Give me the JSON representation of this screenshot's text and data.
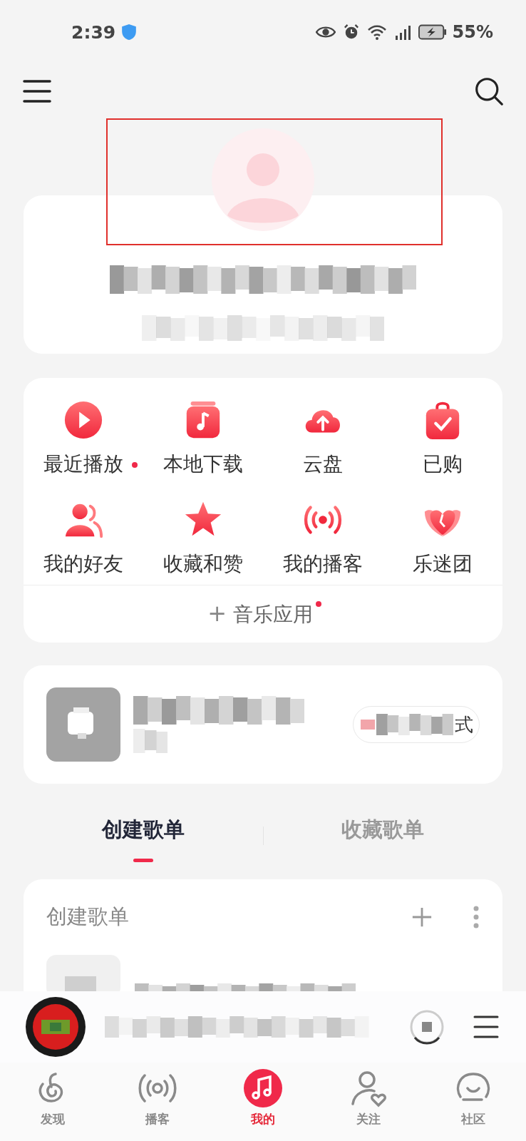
{
  "status_bar": {
    "time": "2:39",
    "battery": "55%"
  },
  "shortcuts": [
    {
      "label": "最近播放",
      "dot": true
    },
    {
      "label": "本地下载",
      "dot": false
    },
    {
      "label": "云盘",
      "dot": false
    },
    {
      "label": "已购",
      "dot": false
    },
    {
      "label": "我的好友",
      "dot": false
    },
    {
      "label": "收藏和赞",
      "dot": false
    },
    {
      "label": "我的播客",
      "dot": false
    },
    {
      "label": "乐迷团",
      "dot": false
    }
  ],
  "music_apps": {
    "icon": "+",
    "label": "音乐应用",
    "dot": true
  },
  "liked": {
    "button_tail": "式"
  },
  "playlist_tabs": [
    {
      "label": "创建歌单",
      "selected": true
    },
    {
      "label": "收藏歌单",
      "selected": false
    }
  ],
  "playlist_section": {
    "title": "创建歌单"
  },
  "bottom_nav": [
    {
      "label": "发现",
      "selected": false
    },
    {
      "label": "播客",
      "selected": false
    },
    {
      "label": "我的",
      "selected": true
    },
    {
      "label": "关注",
      "selected": false
    },
    {
      "label": "社区",
      "selected": false
    }
  ]
}
